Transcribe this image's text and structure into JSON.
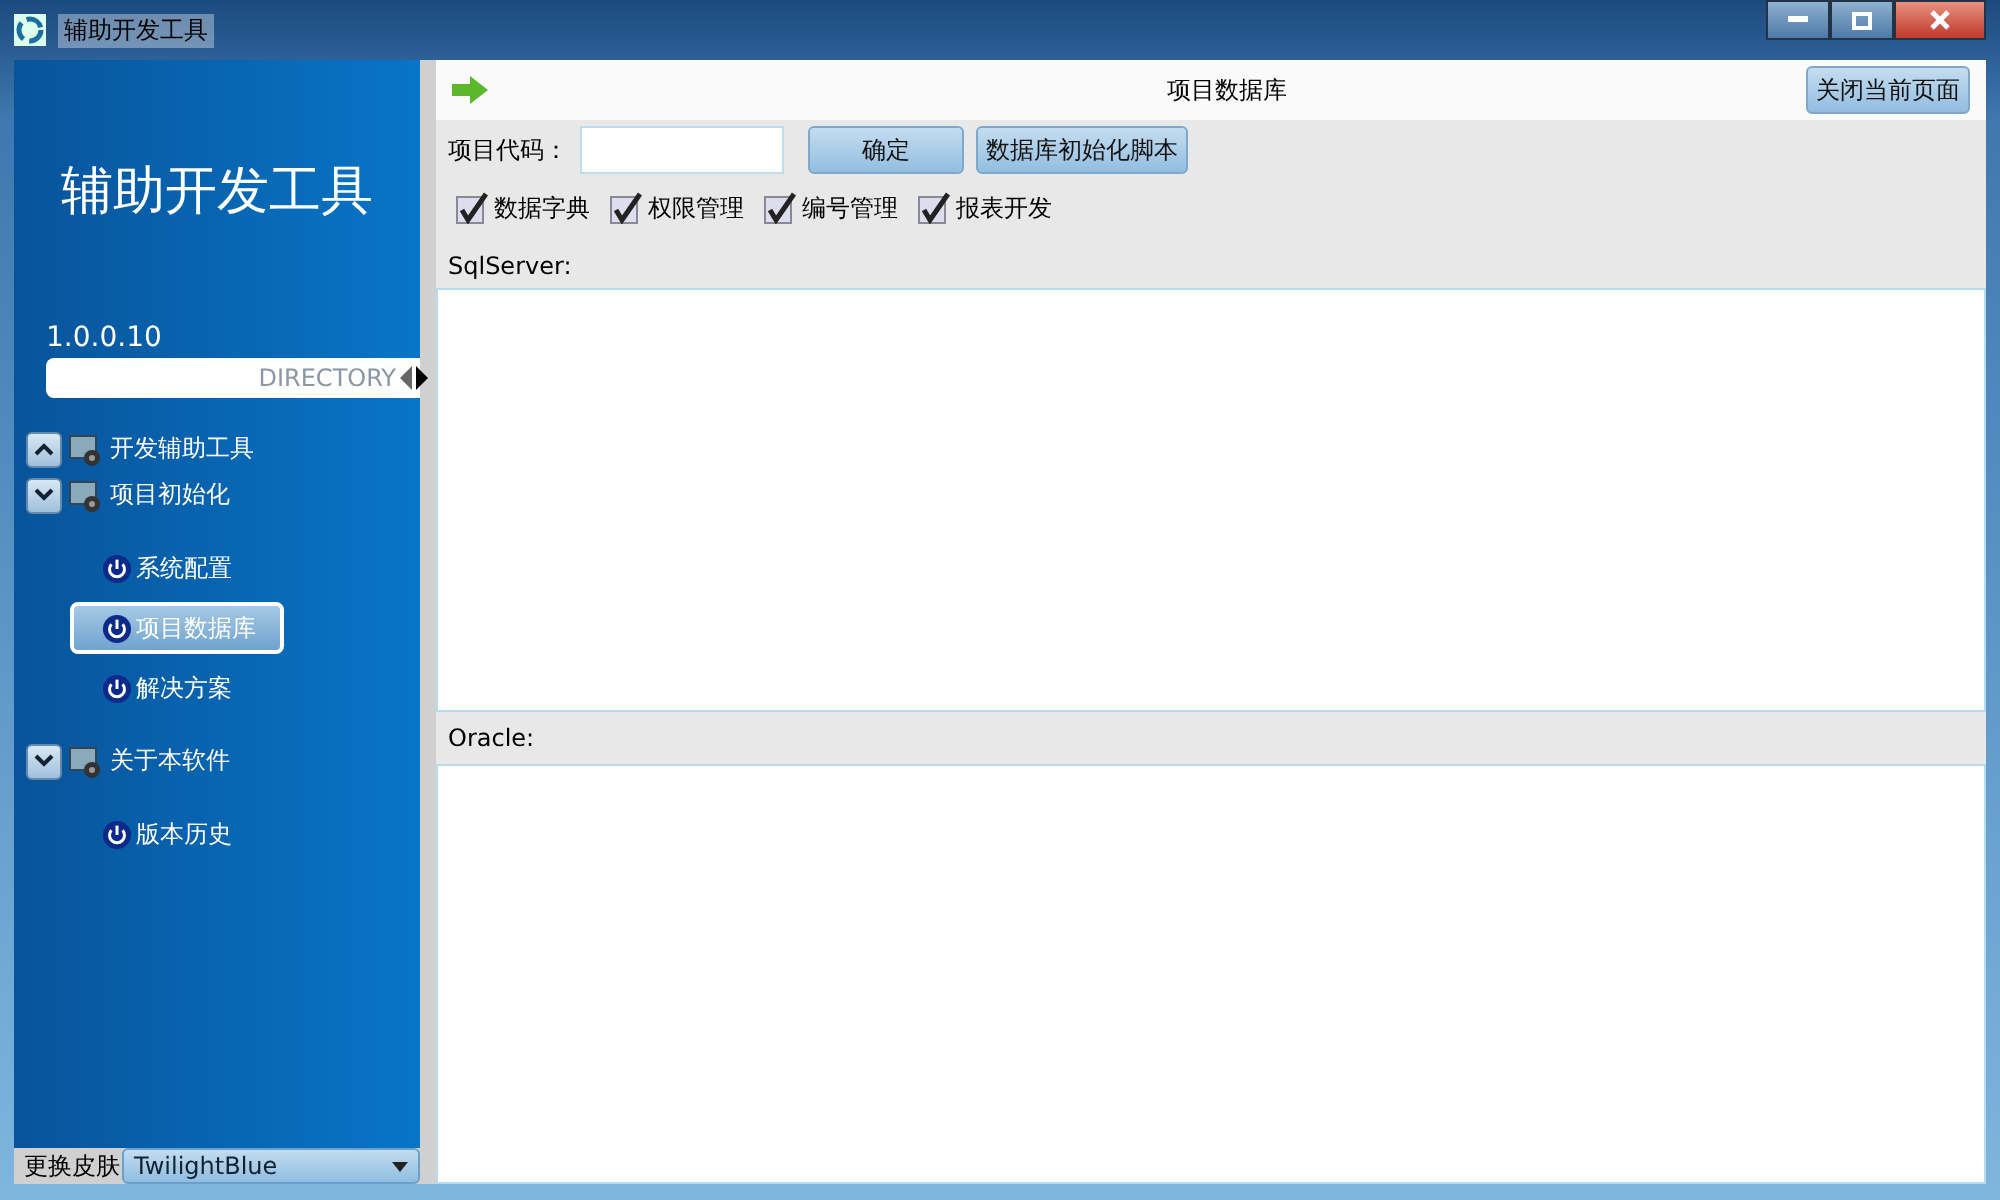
{
  "window": {
    "title": "辅助开发工具"
  },
  "sidebar": {
    "app_title": "辅助开发工具",
    "version": "1.0.0.10",
    "directory_label": "DIRECTORY",
    "groups": [
      {
        "label": "开发辅助工具",
        "expanded": false
      },
      {
        "label": "项目初始化",
        "expanded": true,
        "children": [
          {
            "label": "系统配置",
            "selected": false
          },
          {
            "label": "项目数据库",
            "selected": true
          },
          {
            "label": "解决方案",
            "selected": false
          }
        ]
      },
      {
        "label": "关于本软件",
        "expanded": true,
        "children": [
          {
            "label": "版本历史",
            "selected": false
          }
        ]
      }
    ],
    "skin_label": "更换皮肤",
    "skin_value": "TwilightBlue"
  },
  "page": {
    "title": "项目数据库",
    "close_button": "关闭当前页面",
    "project_code_label": "项目代码：",
    "confirm_button": "确定",
    "init_script_button": "数据库初始化脚本",
    "options": [
      {
        "label": "数据字典",
        "checked": true
      },
      {
        "label": "权限管理",
        "checked": true
      },
      {
        "label": "编号管理",
        "checked": true
      },
      {
        "label": "报表开发",
        "checked": true
      }
    ],
    "sqlserver_label": "SqlServer:",
    "oracle_label": "Oracle:"
  }
}
